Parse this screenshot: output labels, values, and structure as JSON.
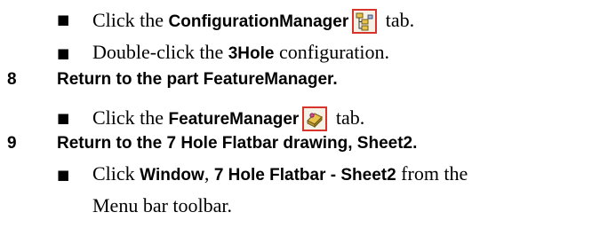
{
  "steps": [
    {
      "bullets": [
        {
          "before": "Click the ",
          "bold": "ConfigurationManager",
          "icon": "configuration-manager-icon",
          "after": " tab."
        },
        {
          "before": "Double-click the ",
          "bold": "3Hole",
          "after": " configuration."
        }
      ]
    },
    {
      "number": "8",
      "heading": "Return to the part FeatureManager.",
      "bullets": [
        {
          "before": "Click the ",
          "bold": "FeatureManager",
          "icon": "feature-manager-icon",
          "after": " tab."
        }
      ]
    },
    {
      "number": "9",
      "heading": "Return to the 7 Hole Flatbar drawing, Sheet2.",
      "bullets": [
        {
          "before": "Click ",
          "bold": "Window",
          "middle": ", ",
          "bold2": "7 Hole Flatbar - Sheet2",
          "after": " from the",
          "line2": "Menu bar toolbar."
        }
      ]
    }
  ],
  "bullet_glyph": "■",
  "colors": {
    "icon_border": "#d9342b",
    "icon_bg": "#f4f1e6"
  }
}
